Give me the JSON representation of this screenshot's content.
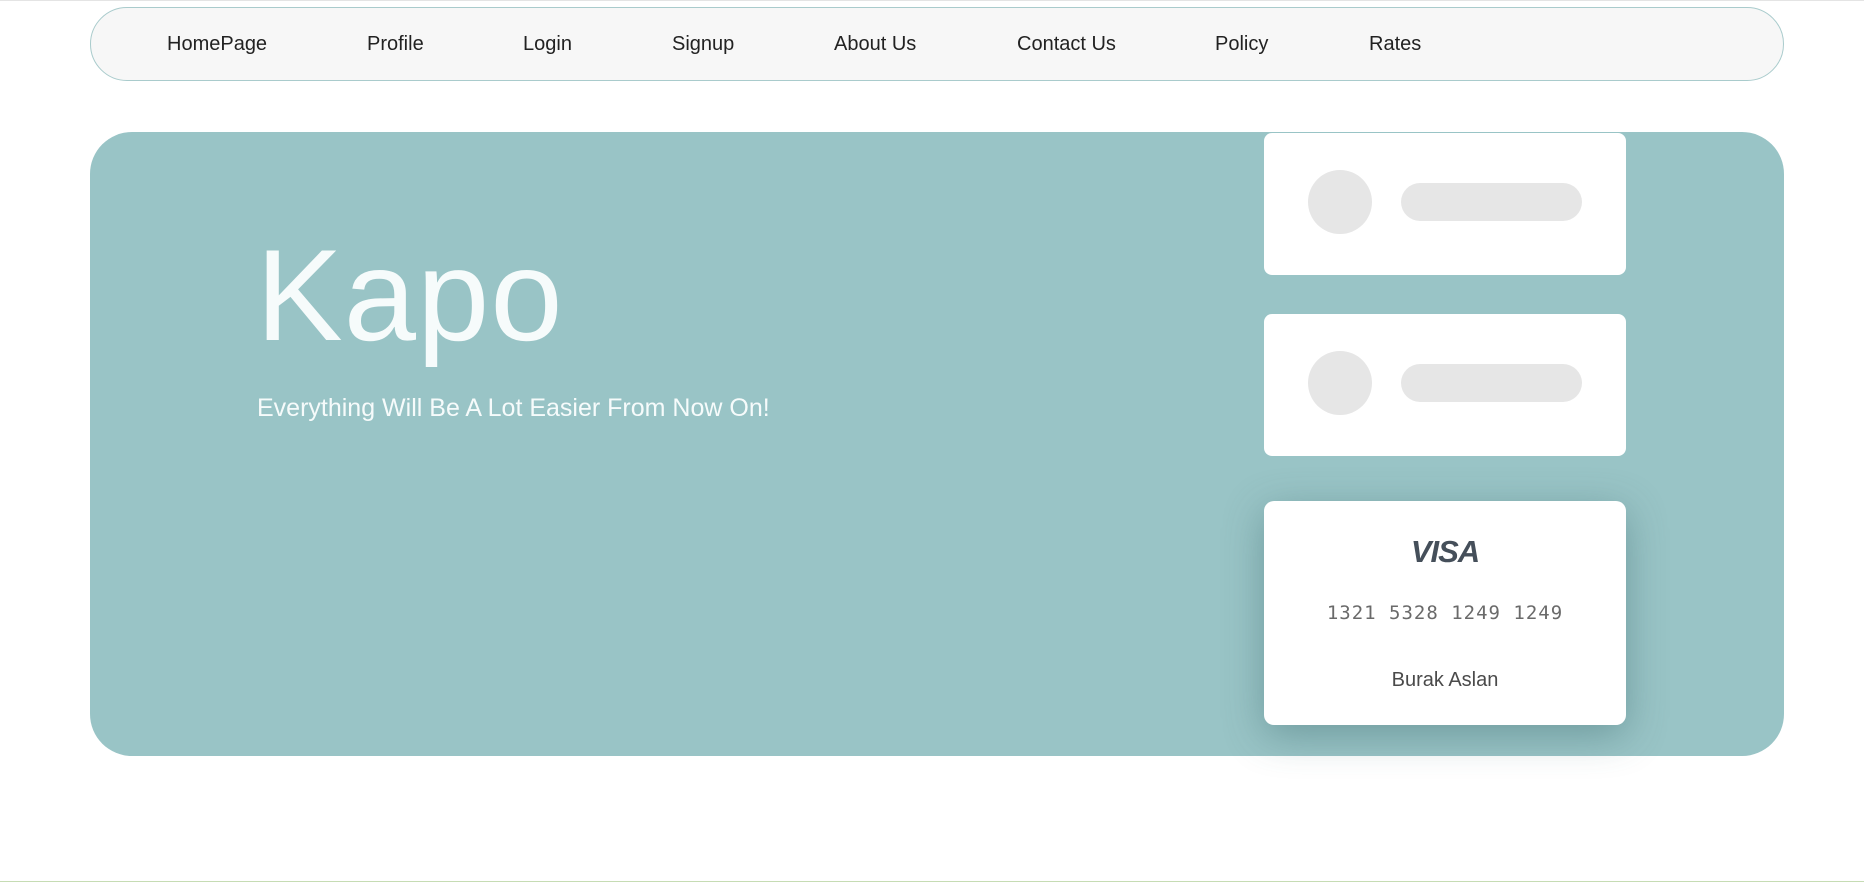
{
  "nav": {
    "items": [
      {
        "label": "HomePage"
      },
      {
        "label": "Profile"
      },
      {
        "label": "Login"
      },
      {
        "label": "Signup"
      },
      {
        "label": "About Us"
      },
      {
        "label": "Contact Us"
      },
      {
        "label": "Policy"
      },
      {
        "label": "Rates"
      }
    ]
  },
  "hero": {
    "title": "Kapo",
    "subtitle": "Everything Will Be A Lot Easier From Now On!"
  },
  "card": {
    "brand": "VISA",
    "number": "1321 5328 1249 1249",
    "holder": "Burak Aslan"
  },
  "colors": {
    "hero_bg": "#99c4c6",
    "nav_bg": "#f7f7f7",
    "nav_border": "#a9cbcc",
    "placeholder": "#e6e6e6"
  }
}
